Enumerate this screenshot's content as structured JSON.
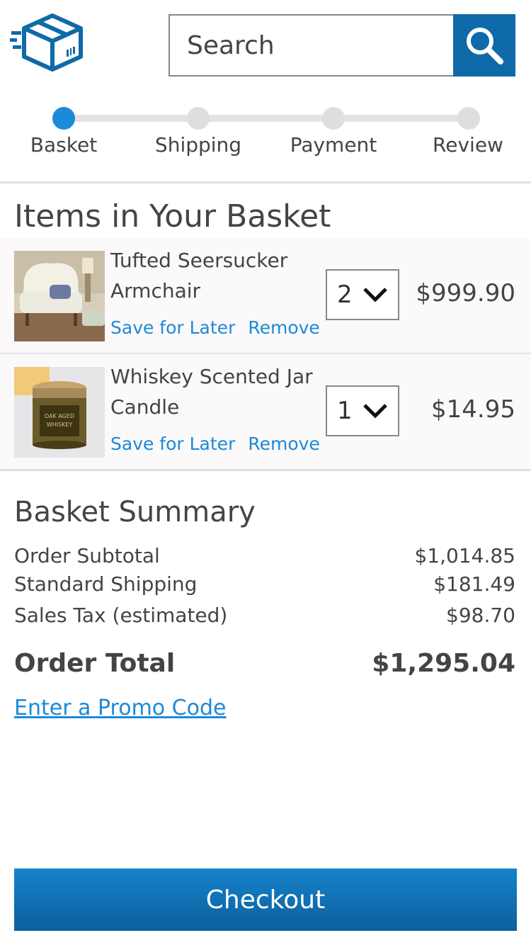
{
  "header": {
    "search_placeholder": "Search"
  },
  "steps": [
    {
      "label": "Basket",
      "active": true
    },
    {
      "label": "Shipping",
      "active": false
    },
    {
      "label": "Payment",
      "active": false
    },
    {
      "label": "Review",
      "active": false
    }
  ],
  "basket": {
    "title": "Items in Your Basket",
    "items": [
      {
        "name": "Tufted Seersucker Armchair",
        "quantity": "2",
        "price": "$999.90",
        "save_label": "Save for Later",
        "remove_label": "Remove"
      },
      {
        "name": "Whiskey Scented Jar Candle",
        "quantity": "1",
        "price": "$14.95",
        "save_label": "Save for Later",
        "remove_label": "Remove"
      }
    ]
  },
  "summary": {
    "title": "Basket Summary",
    "rows": [
      {
        "label": "Order Subtotal",
        "value": "$1,014.85"
      },
      {
        "label": "Standard Shipping",
        "value": "$181.49"
      },
      {
        "label": "Sales Tax (estimated)",
        "value": "$98.70"
      }
    ],
    "total_label": "Order Total",
    "total_value": "$1,295.04",
    "promo_label": "Enter a Promo Code"
  },
  "checkout_label": "Checkout",
  "colors": {
    "accent": "#1b8ad8",
    "brand": "#0e6aa8"
  },
  "candle_label": {
    "line1": "OAK AGED",
    "line2": "WHISKEY"
  }
}
